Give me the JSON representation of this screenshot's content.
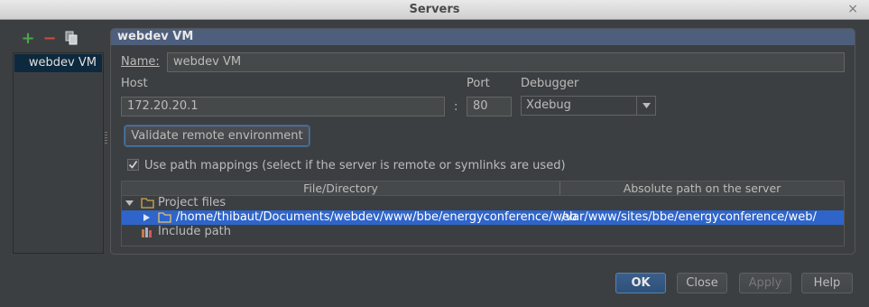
{
  "window": {
    "title": "Servers"
  },
  "toolbar": {
    "icons": [
      "add-icon",
      "remove-icon",
      "copy-icon"
    ]
  },
  "server_list": [
    {
      "label": "webdev VM",
      "selected": true
    }
  ],
  "panel": {
    "title": "webdev VM"
  },
  "form": {
    "name_label": "Name:",
    "name_value": "webdev VM",
    "host_label": "Host",
    "host_value": "172.20.20.1",
    "colon": ":",
    "port_label": "Port",
    "port_value": "80",
    "debugger_label": "Debugger",
    "debugger_value": "Xdebug",
    "validate_label": "Validate remote environment",
    "use_path_mappings_label": "Use path mappings (select if the server is remote or symlinks are used)",
    "use_path_mappings_checked": true
  },
  "mappings": {
    "columns": [
      "File/Directory",
      "Absolute path on the server"
    ],
    "rows": [
      {
        "label": "Project files",
        "expanded": true,
        "icon": "folder-icon"
      },
      {
        "label": "/home/thibaut/Documents/webdev/www/bbe/energyconference/web",
        "server_path": "/var/www/sites/bbe/energyconference/web/",
        "selected": true,
        "icon": "folder-icon"
      },
      {
        "label": "Include path",
        "icon": "library-icon"
      }
    ]
  },
  "buttons": {
    "ok": "OK",
    "close": "Close",
    "apply": "Apply",
    "help": "Help"
  },
  "colors": {
    "selection": "#2f65ca",
    "panel_header": "#4e5e7d",
    "list_selection": "#0d293e",
    "background": "#3c3f41"
  }
}
